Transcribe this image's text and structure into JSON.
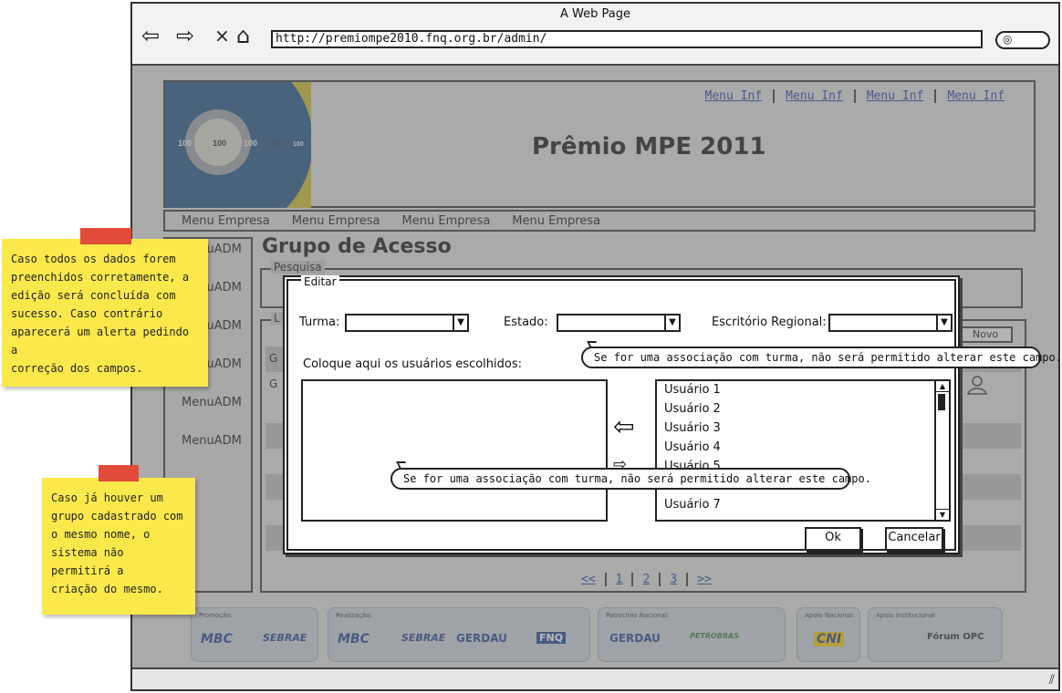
{
  "browser": {
    "window_title": "A Web Page",
    "address": "http://premiompe2010.fnq.org.br/admin/",
    "back_glyph": "⇦",
    "forward_glyph": "⇨",
    "stop_glyph": "×",
    "home_glyph": "⌂"
  },
  "header": {
    "top_menu": [
      "Menu Inf",
      "Menu Inf",
      "Menu Inf",
      "Menu Inf"
    ],
    "site_title": "Prêmio MPE 2011",
    "logo_labels": [
      "100",
      "100",
      "100",
      "100",
      "100"
    ]
  },
  "main_menu": [
    "Menu Empresa",
    "Menu Empresa",
    "Menu Empresa",
    "Menu Empresa"
  ],
  "side_menu": [
    "MenuADM",
    "MenuADM",
    "MenuADM",
    "MenuADM",
    "MenuADM",
    "MenuADM"
  ],
  "content": {
    "page_title": "Grupo de Acesso",
    "pesquisa_legend": "Pesquisa",
    "list_legend": "L",
    "novo_label": "Novo",
    "row_labels": [
      "G",
      "G"
    ]
  },
  "pagination": {
    "prev": "<<",
    "pages": [
      "1",
      "2",
      "3"
    ],
    "next": ">>"
  },
  "footer": {
    "groups": [
      {
        "label": "Promoção:",
        "logos": [
          "MBC",
          "SEBRAE"
        ]
      },
      {
        "label": "Realização:",
        "logos": [
          "MBC",
          "SEBRAE",
          "GERDAU",
          "FNQ"
        ]
      },
      {
        "label": "Patrocínio Nacional:",
        "logos": [
          "GERDAU",
          "PETROBRAS"
        ]
      },
      {
        "label": "Apoio Nacional:",
        "logos": [
          "CNI"
        ]
      },
      {
        "label": "Apoio Institucional:",
        "logos": [
          "Fórum OPC"
        ]
      }
    ]
  },
  "dialog": {
    "legend": "Editar",
    "turma_label": "Turma:",
    "estado_label": "Estado:",
    "escritorio_label": "Escritório Regional:",
    "chosen_label": "Coloque aqui os usuários escolhidos:",
    "users": [
      "Usuário 1",
      "Usuário 2",
      "Usuário 3",
      "Usuário 4",
      "Usuário 5",
      "Usuário 7"
    ],
    "ok_label": "Ok",
    "cancel_label": "Cancelar",
    "callout_text": "Se for uma associação com turma, não será permitido alterar este campo."
  },
  "notes": {
    "note1": [
      "Caso todos os dados forem",
      "preenchidos corretamente, a",
      "edição será concluída com",
      "sucesso. Caso contrário",
      "aparecerá um alerta pedindo a",
      "correção dos campos."
    ],
    "note2": [
      "Caso já houver um",
      "grupo cadastrado com",
      "o mesmo nome, o",
      "sistema não permitirá a",
      "criação do mesmo."
    ]
  },
  "colors": {
    "link": "#1c3fa0",
    "sticky": "#fbe94c",
    "tape": "#e24a3a"
  }
}
